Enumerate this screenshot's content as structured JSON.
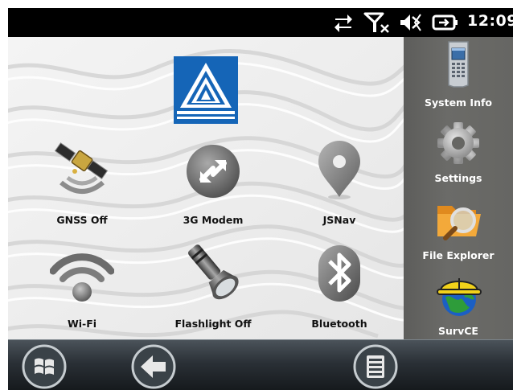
{
  "status_bar": {
    "time": "12:09",
    "icons": [
      "sync-arrows-icon",
      "no-signal-icon",
      "volume-muted-icon",
      "battery-charging-icon"
    ]
  },
  "main": {
    "logo": "pyramid-logo",
    "apps": [
      {
        "id": "gnss",
        "label": "GNSS Off",
        "icon": "satellite-icon"
      },
      {
        "id": "modem",
        "label": "3G Modem",
        "icon": "modem-icon"
      },
      {
        "id": "jsnav",
        "label": "JSNav",
        "icon": "map-pin-icon"
      },
      {
        "id": "wifi",
        "label": "Wi-Fi",
        "icon": "wifi-icon"
      },
      {
        "id": "flashlight",
        "label": "Flashlight Off",
        "icon": "flashlight-icon"
      },
      {
        "id": "bluetooth",
        "label": "Bluetooth",
        "icon": "bluetooth-icon"
      }
    ]
  },
  "sidebar": {
    "items": [
      {
        "label": "System Info",
        "icon": "handheld-device-icon"
      },
      {
        "label": "Settings",
        "icon": "gear-icon"
      },
      {
        "label": "File Explorer",
        "icon": "folder-search-icon"
      },
      {
        "label": "SurvCE",
        "icon": "hardhat-globe-icon"
      }
    ]
  },
  "taskbar": {
    "buttons": [
      "start-button",
      "back-button",
      "menu-button"
    ]
  },
  "colors": {
    "logo_blue": "#1565b7",
    "sidebar_bg": "#666663",
    "taskbar_bg": "#2a3036"
  }
}
